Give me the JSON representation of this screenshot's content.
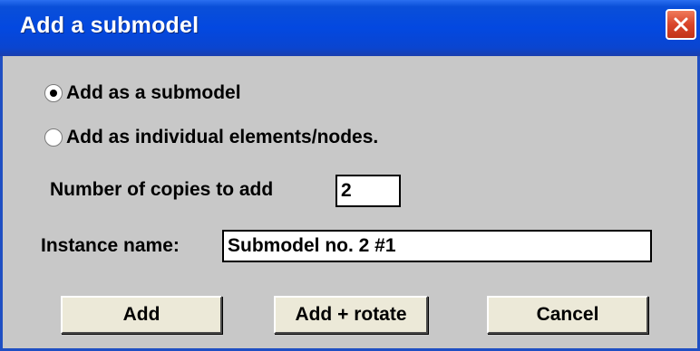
{
  "dialog": {
    "title": "Add a submodel",
    "close_icon": "close-icon"
  },
  "options": {
    "add_as_submodel": {
      "label": "Add as a submodel",
      "selected": true
    },
    "add_as_individual": {
      "label": "Add as individual elements/nodes.",
      "selected": false
    }
  },
  "copies": {
    "label": "Number of copies to add",
    "value": "2"
  },
  "instance": {
    "label": "Instance name:",
    "value": "Submodel no. 2 #1"
  },
  "buttons": {
    "add": "Add",
    "add_rotate": "Add + rotate",
    "cancel": "Cancel"
  },
  "colors": {
    "titlebar": "#0348e0",
    "background": "#c8c8c8",
    "close": "#d9452a"
  }
}
